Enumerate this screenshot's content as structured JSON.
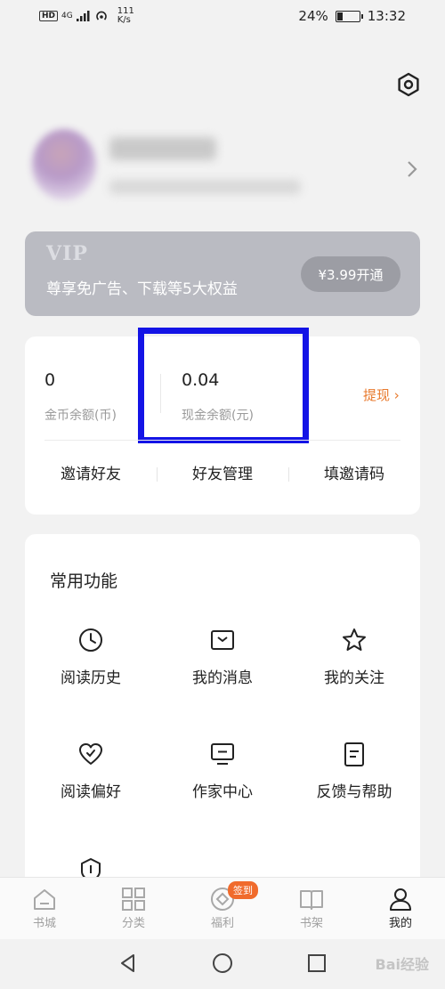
{
  "status_bar": {
    "hd": "HD",
    "network_type": "4G",
    "speed_value": "111",
    "speed_unit": "K/s",
    "battery_percent": "24%",
    "battery_level": 0.24,
    "time": "13:32"
  },
  "header": {
    "settings_icon": "hexagon-gear-icon"
  },
  "profile": {
    "arrow_icon": "chevron-right-icon"
  },
  "vip": {
    "title": "VIP",
    "description": "尊享免广告、下载等5大权益",
    "button_label": "¥3.99开通"
  },
  "wallet": {
    "coin_value": "0",
    "coin_label": "金币余额(币)",
    "cash_value": "0.04",
    "cash_label": "现金余额(元)",
    "withdraw_label": "提现 ›",
    "links": [
      "邀请好友",
      "好友管理",
      "填邀请码"
    ],
    "highlight_color": "#1414e6"
  },
  "functions": {
    "title": "常用功能",
    "items": [
      {
        "label": "阅读历史",
        "icon": "clock-icon"
      },
      {
        "label": "我的消息",
        "icon": "message-box-icon"
      },
      {
        "label": "我的关注",
        "icon": "star-icon"
      },
      {
        "label": "阅读偏好",
        "icon": "heart-check-icon"
      },
      {
        "label": "作家中心",
        "icon": "monitor-icon"
      },
      {
        "label": "反馈与帮助",
        "icon": "document-icon"
      },
      {
        "label": "",
        "icon": "shield-icon"
      }
    ]
  },
  "tabbar": {
    "tabs": [
      {
        "label": "书城",
        "icon": "bookstore-icon",
        "active": false
      },
      {
        "label": "分类",
        "icon": "grid-icon",
        "active": false
      },
      {
        "label": "福利",
        "icon": "gift-coin-icon",
        "active": false,
        "badge": "签到"
      },
      {
        "label": "书架",
        "icon": "open-book-icon",
        "active": false
      },
      {
        "label": "我的",
        "icon": "person-icon",
        "active": true
      }
    ]
  },
  "system_nav": {
    "back_icon": "triangle-back-icon",
    "home_icon": "circle-home-icon",
    "recents_icon": "square-recents-icon",
    "watermark": "Bai经验"
  },
  "colors": {
    "accent": "#e8792c",
    "badge": "#f06b2c",
    "vip_card": "#babbc2"
  }
}
